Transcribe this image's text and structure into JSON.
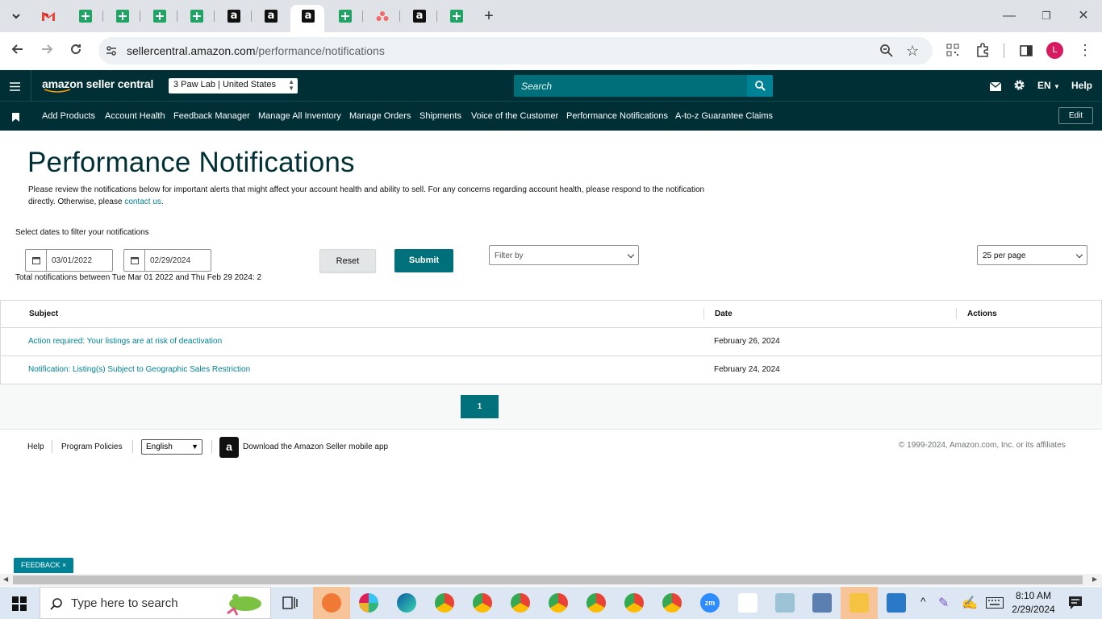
{
  "browser": {
    "url_host": "sellercentral.amazon.com",
    "url_path": "/performance/notifications",
    "new_tab_symbol": "+"
  },
  "header": {
    "logo_text": "amazon seller central",
    "store": "3 Paw Lab | United States",
    "search_placeholder": "Search",
    "language": "EN",
    "help": "Help"
  },
  "nav": {
    "items": [
      "Add Products",
      "Account Health",
      "Feedback Manager",
      "Manage All Inventory",
      "Manage Orders",
      "Shipments",
      "Voice of the Customer",
      "Performance Notifications",
      "A-to-z Guarantee Claims"
    ],
    "edit_label": "Edit"
  },
  "page": {
    "title": "Performance Notifications",
    "intro": "Please review the notifications below for important alerts that might affect your account health and ability to sell. For any concerns regarding account health, please respond to the notification directly. Otherwise, please ",
    "contact_link": "contact us",
    "contact_suffix": ".",
    "filter_prompt": "Select dates to filter your notifications",
    "start_date": "03/01/2022",
    "end_date": "02/29/2024",
    "reset_label": "Reset",
    "submit_label": "Submit",
    "filter_placeholder": "Filter by",
    "per_page": "25 per page",
    "total_text": "Total notifications between Tue Mar 01 2022 and Thu Feb 29 2024: 2"
  },
  "table": {
    "headers": {
      "subject": "Subject",
      "date": "Date",
      "actions": "Actions"
    },
    "rows": [
      {
        "subject": "Action required: Your listings are at risk of deactivation",
        "date": "February 26, 2024"
      },
      {
        "subject": "Notification: Listing(s) Subject to Geographic Sales Restriction",
        "date": "February 24, 2024"
      }
    ]
  },
  "pagination": {
    "current": "1"
  },
  "footer": {
    "help": "Help",
    "program_policies": "Program Policies",
    "language": "English",
    "app_text": "Download the Amazon Seller mobile app",
    "copyright": "© 1999-2024, Amazon.com, Inc. or its affiliates",
    "feedback": "FEEDBACK ×"
  },
  "taskbar": {
    "search_placeholder": "Type here to search",
    "time": "8:10 AM",
    "date": "2/29/2024"
  },
  "colors": {
    "header_bg": "#002f36",
    "accent_teal": "#008296",
    "submit_bg": "#00707a"
  }
}
